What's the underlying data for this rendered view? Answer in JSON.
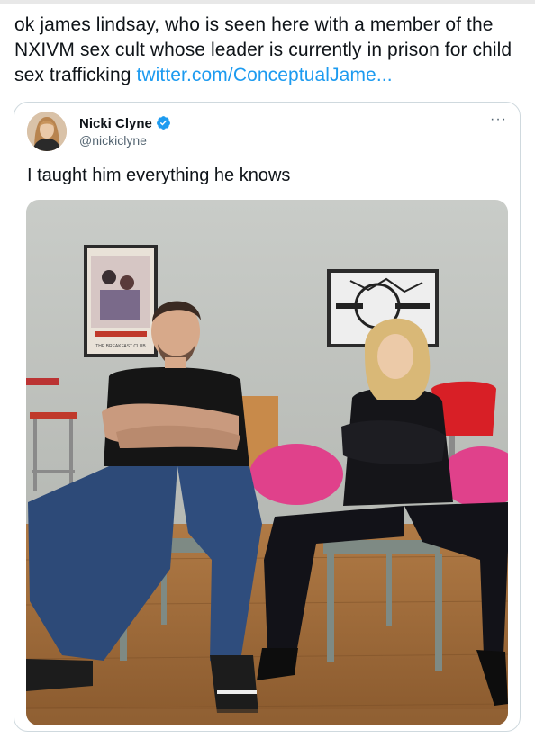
{
  "tweet": {
    "text": "ok james lindsay, who is seen here with a member of the NXIVM sex cult whose leader is currently in prison for child sex trafficking ",
    "link": "twitter.com/ConceptualJame..."
  },
  "quoted_tweet": {
    "display_name": "Nicki Clyne",
    "handle": "@nickiclyne",
    "text": "I taught him everything he knows",
    "more_label": "···",
    "verified_icon": "verified-badge-icon"
  },
  "photo": {
    "poster_caption": "THE BREAKFAST CLUB"
  },
  "colors": {
    "link": "#1d9bf0",
    "text": "#0f1419",
    "secondary": "#536471",
    "border": "#cfd9de"
  }
}
